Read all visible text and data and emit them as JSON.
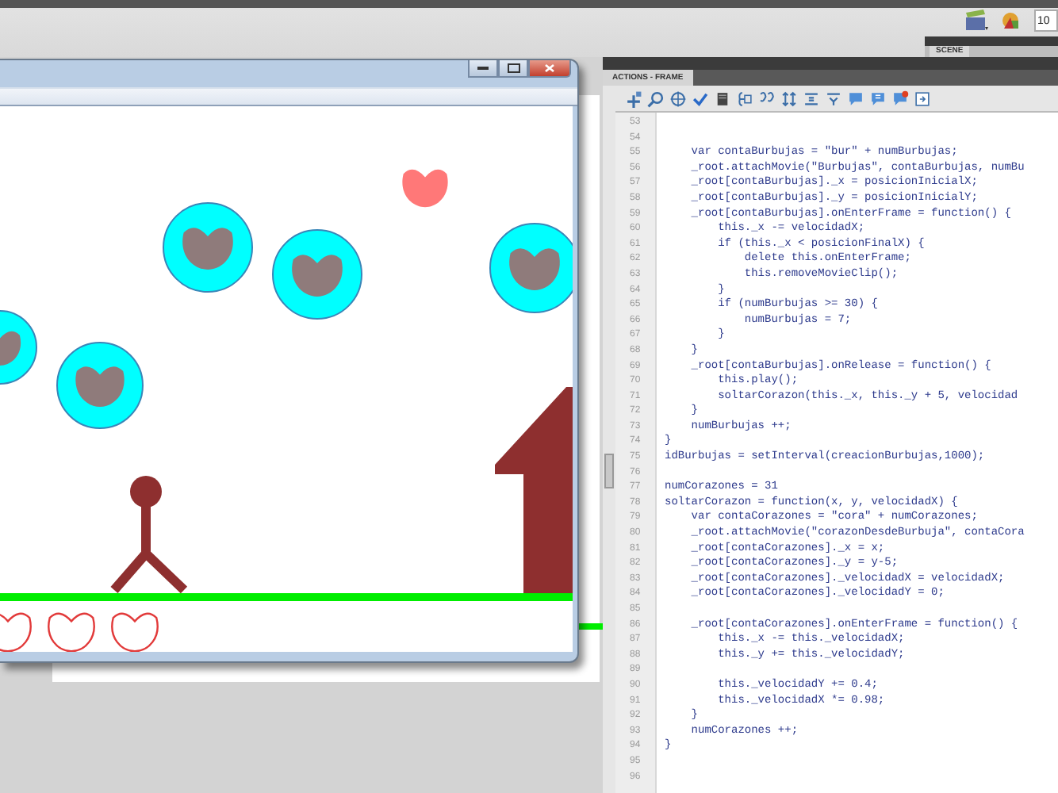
{
  "toolbar": {
    "zoom_field": "10"
  },
  "scene_panel": {
    "tab": "SCENE"
  },
  "actions_panel": {
    "tab": "ACTIONS - FRAME",
    "code_lines": [
      {
        "number": "53"
      },
      {
        "number": "54"
      },
      {
        "number": "55",
        "code": "    var contaBurbujas = \"bur\" + numBurbujas;"
      },
      {
        "number": "56",
        "code": "    _root.attachMovie(\"Burbujas\", contaBurbujas, numBu"
      },
      {
        "number": "57",
        "code": "    _root[contaBurbujas]._x = posicionInicialX;"
      },
      {
        "number": "58",
        "code": "    _root[contaBurbujas]._y = posicionInicialY;"
      },
      {
        "number": "59",
        "code": "    _root[contaBurbujas].onEnterFrame = function() {"
      },
      {
        "number": "60",
        "code": "        this._x -= velocidadX;"
      },
      {
        "number": "61",
        "code": "        if (this._x < posicionFinalX) {"
      },
      {
        "number": "62",
        "code": "            delete this.onEnterFrame;"
      },
      {
        "number": "63",
        "code": "            this.removeMovieClip();"
      },
      {
        "number": "64",
        "code": "        }"
      },
      {
        "number": "65",
        "code": "        if (numBurbujas >= 30) {"
      },
      {
        "number": "66",
        "code": "            numBurbujas = 7;"
      },
      {
        "number": "67",
        "code": "        }"
      },
      {
        "number": "68",
        "code": "    }"
      },
      {
        "number": "69",
        "code": "    _root[contaBurbujas].onRelease = function() {"
      },
      {
        "number": "70",
        "code": "        this.play();"
      },
      {
        "number": "71",
        "code": "        soltarCorazon(this._x, this._y + 5, velocidad"
      },
      {
        "number": "72",
        "code": "    }"
      },
      {
        "number": "73",
        "code": "    numBurbujas ++;"
      },
      {
        "number": "74",
        "code": "}"
      },
      {
        "number": "75",
        "code": "idBurbujas = setInterval(creacionBurbujas,1000);"
      },
      {
        "number": "76"
      },
      {
        "number": "77",
        "code": "numCorazones = 31"
      },
      {
        "number": "78",
        "code": "soltarCorazon = function(x, y, velocidadX) {"
      },
      {
        "number": "79",
        "code": "    var contaCorazones = \"cora\" + numCorazones;"
      },
      {
        "number": "80",
        "code": "    _root.attachMovie(\"corazonDesdeBurbuja\", contaCora"
      },
      {
        "number": "81",
        "code": "    _root[contaCorazones]._x = x;"
      },
      {
        "number": "82",
        "code": "    _root[contaCorazones]._y = y-5;"
      },
      {
        "number": "83",
        "code": "    _root[contaCorazones]._velocidadX = velocidadX;"
      },
      {
        "number": "84",
        "code": "    _root[contaCorazones]._velocidadY = 0;"
      },
      {
        "number": "85"
      },
      {
        "number": "86",
        "code": "    _root[contaCorazones].onEnterFrame = function() {"
      },
      {
        "number": "87",
        "code": "        this._x -= this._velocidadX;"
      },
      {
        "number": "88",
        "code": "        this._y += this._velocidadY;"
      },
      {
        "number": "89"
      },
      {
        "number": "90",
        "code": "        this._velocidadY += 0.4;"
      },
      {
        "number": "91",
        "code": "        this._velocidadX *= 0.98;"
      },
      {
        "number": "92",
        "code": "    }"
      },
      {
        "number": "93",
        "code": "    numCorazones ++;"
      },
      {
        "number": "94",
        "code": "}"
      },
      {
        "number": "95"
      },
      {
        "number": "96"
      }
    ]
  }
}
